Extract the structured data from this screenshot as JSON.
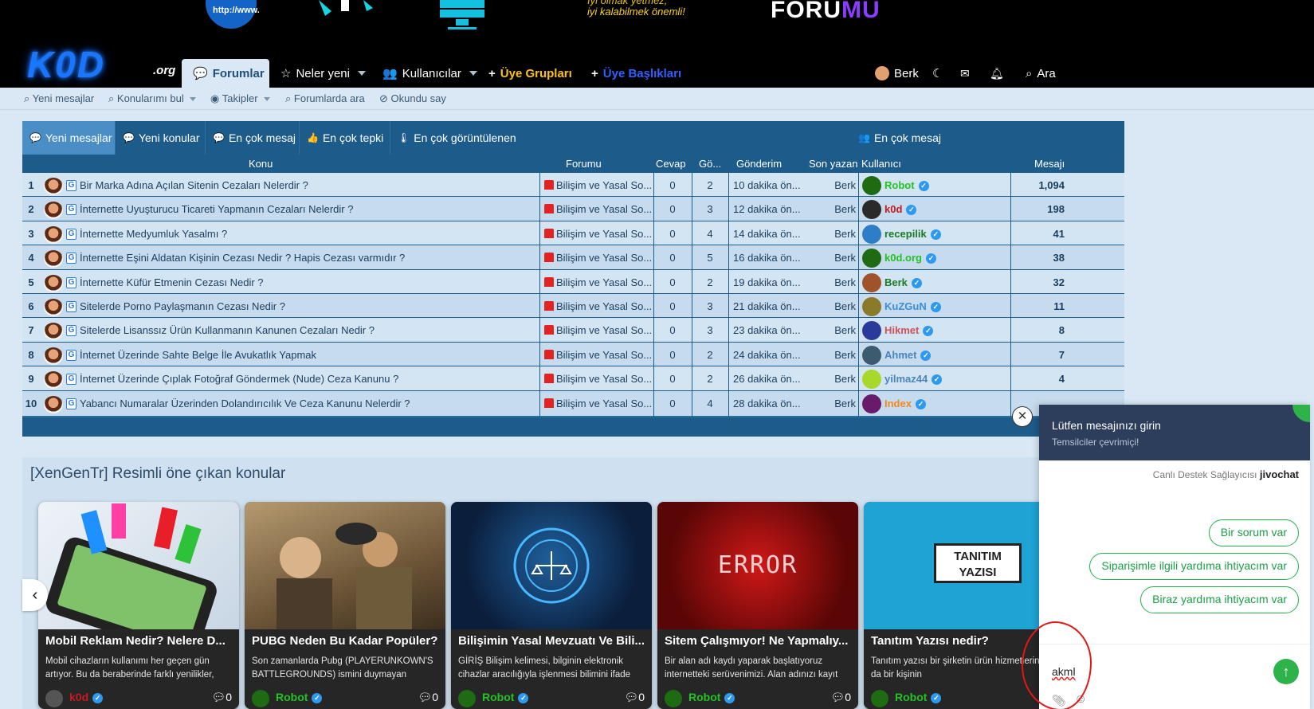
{
  "banner": {
    "slogan_line1": "İyi olmak yetmez,",
    "slogan_line2": "iyi kalabilmek önemli!",
    "forumu_text": "FORU",
    "forumu_tail": "MU"
  },
  "logo": {
    "main": "K0D",
    "org": ".org"
  },
  "nav": {
    "items": [
      {
        "label": "Forumlar",
        "icon": "comments-icon"
      },
      {
        "label": "Neler yeni",
        "icon": "star-icon"
      },
      {
        "label": "Kullanıcılar",
        "icon": "users-icon"
      },
      {
        "label": "Üye Grupları",
        "icon": "plus-icon"
      },
      {
        "label": "Üye Başlıkları",
        "icon": "plus-icon"
      }
    ],
    "user": "Berk",
    "search": "Ara"
  },
  "subnav": [
    "Yeni mesajlar",
    "Konularımı bul",
    "Takipler",
    "Forumlarda ara",
    "Okundu say"
  ],
  "tabs": [
    "Yeni mesajlar",
    "Yeni konular",
    "En çok mesaj",
    "En çok tepki",
    "En çok görüntülenen"
  ],
  "users_tab": "En çok mesaj",
  "columns": {
    "topic": "Konu",
    "forum": "Forumu",
    "replies": "Cevap",
    "views": "Gö...",
    "posted": "Gönderim",
    "last": "Son yazan",
    "user": "Kullanıcı",
    "messages": "Mesajı"
  },
  "rows": [
    {
      "n": "1",
      "title": "Bir Marka Adına Açılan Sitenin Cezaları Nelerdir ?",
      "forum": "Bilişim ve Yasal So...",
      "replies": "0",
      "views": "2",
      "time": "10 dakika ön...",
      "last": "Berk",
      "user": "Robot",
      "ucolor": "#22c322",
      "ubg": "#1e6b14",
      "count": "1,094"
    },
    {
      "n": "2",
      "title": "İnternette Uyuşturucu Ticareti Yapmanın Cezaları Nelerdir ?",
      "forum": "Bilişim ve Yasal So...",
      "replies": "0",
      "views": "3",
      "time": "12 dakika ön...",
      "last": "Berk",
      "user": "k0d",
      "ucolor": "#c8191e",
      "ubg": "#2a2a2a",
      "count": "198"
    },
    {
      "n": "3",
      "title": "İnternette Medyumluk Yasalmı ?",
      "forum": "Bilişim ve Yasal So...",
      "replies": "0",
      "views": "4",
      "time": "14 dakika ön...",
      "last": "Berk",
      "user": "recepilik",
      "ucolor": "#1b7a24",
      "ubg": "#2e7ec7",
      "count": "41"
    },
    {
      "n": "4",
      "title": "İnternette Eşini Aldatan Kişinin Cezası Nedir ? Hapis Cezası varmıdır ?",
      "forum": "Bilişim ve Yasal So...",
      "replies": "0",
      "views": "5",
      "time": "16 dakika ön...",
      "last": "Berk",
      "user": "k0d.org",
      "ucolor": "#22c322",
      "ubg": "#1e6b14",
      "count": "38"
    },
    {
      "n": "5",
      "title": "İnternette Küfür Etmenin Cezası Nedir ?",
      "forum": "Bilişim ve Yasal So...",
      "replies": "0",
      "views": "2",
      "time": "19 dakika ön...",
      "last": "Berk",
      "user": "Berk",
      "ucolor": "#1b7a24",
      "ubg": "#a0532a",
      "count": "32"
    },
    {
      "n": "6",
      "title": "Sitelerde Porno Paylaşmanın Cezası Nedir ?",
      "forum": "Bilişim ve Yasal So...",
      "replies": "0",
      "views": "3",
      "time": "21 dakika ön...",
      "last": "Berk",
      "user": "KuZGuN",
      "ucolor": "#3a8fd8",
      "ubg": "#8a7a2a",
      "count": "11"
    },
    {
      "n": "7",
      "title": "Sitelerde Lisanssız Ürün Kullanmanın Kanunen Cezaları Nedir ?",
      "forum": "Bilişim ve Yasal So...",
      "replies": "0",
      "views": "3",
      "time": "23 dakika ön...",
      "last": "Berk",
      "user": "Hikmet",
      "ucolor": "#d2525a",
      "ubg": "#2a3a9a",
      "count": "8"
    },
    {
      "n": "8",
      "title": "İnternet Üzerinde Sahte Belge İle Avukatlık Yapmak",
      "forum": "Bilişim ve Yasal So...",
      "replies": "0",
      "views": "2",
      "time": "24 dakika ön...",
      "last": "Berk",
      "user": "Ahmet",
      "ucolor": "#4b86b8",
      "ubg": "#3d5b6e",
      "count": "7"
    },
    {
      "n": "9",
      "title": "İnternet Üzerinde Çıplak Fotoğraf Göndermek (Nude) Ceza Kanunu ?",
      "forum": "Bilişim ve Yasal So...",
      "replies": "0",
      "views": "2",
      "time": "26 dakika ön...",
      "last": "Berk",
      "user": "yilmaz44",
      "ucolor": "#4b86b8",
      "ubg": "#a8d82a",
      "count": "4"
    },
    {
      "n": "10",
      "title": "Yabancı Numaralar Üzerinden Dolandırıcılık Ve Ceza Kanunu Nelerdir ?",
      "forum": "Bilişim ve Yasal So...",
      "replies": "0",
      "views": "4",
      "time": "28 dakika ön...",
      "last": "Berk",
      "user": "Index",
      "ucolor": "#f08a1c",
      "ubg": "#6a1a6a",
      "count": ""
    }
  ],
  "featured": {
    "title": "[XenGenTr] Resimli öne çıkan konular",
    "cards": [
      {
        "title": "Mobil Reklam Nedir? Nelere D...",
        "desc": "Mobil cihazların kullanımı her geçen gün artıyor. Bu da beraberinde farklı yenilikler,",
        "user": "k0d",
        "ucolor": "#c8191e",
        "count": "0"
      },
      {
        "title": "PUBG Neden Bu Kadar Popüler?",
        "desc": "Son zamanlarda Pubg (PLAYERUNKOWN'S BATTLEGROUNDS) ismini duymayan",
        "user": "Robot",
        "ucolor": "#22c322",
        "count": "0"
      },
      {
        "title": "Bilişimin Yasal Mevzuatı Ve Bili...",
        "desc": "GİRİŞ Bilişim kelimesi, bilginin elektronik cihazlar aracılığıyla işlenmesi bilimini ifade",
        "user": "Robot",
        "ucolor": "#22c322",
        "count": "0"
      },
      {
        "title": "Sitem Çalışmıyor! Ne Yapmalıy...",
        "desc": "Bir alan adı kaydı yaparak başlatıyoruz internetteki serüvenimizi. Alan adınızı kayıt",
        "user": "Robot",
        "ucolor": "#22c322",
        "count": "0"
      },
      {
        "title": "Tanıtım Yazısı nedir?",
        "desc": "Tanıtım yazısı bir şirketin ürün hizmetlerini ya da bir kişinin",
        "user": "Robot",
        "ucolor": "#22c322",
        "count": ""
      }
    ],
    "card_labels": {
      "error": "ERROR",
      "tanitim": "TANITIM YAZISI"
    }
  },
  "chat": {
    "title": "Lütfen mesajınızı girin",
    "subtitle": "Temsilciler çevrimiçi!",
    "powered": "Canlı Destek Sağlayıcısı",
    "brand": "jivochat",
    "quick": [
      "Bir sorum var",
      "Siparişimle ilgili yardıma ihtiyacım var",
      "Biraz yardıma ihtiyacım var"
    ],
    "input_value": "akml"
  }
}
